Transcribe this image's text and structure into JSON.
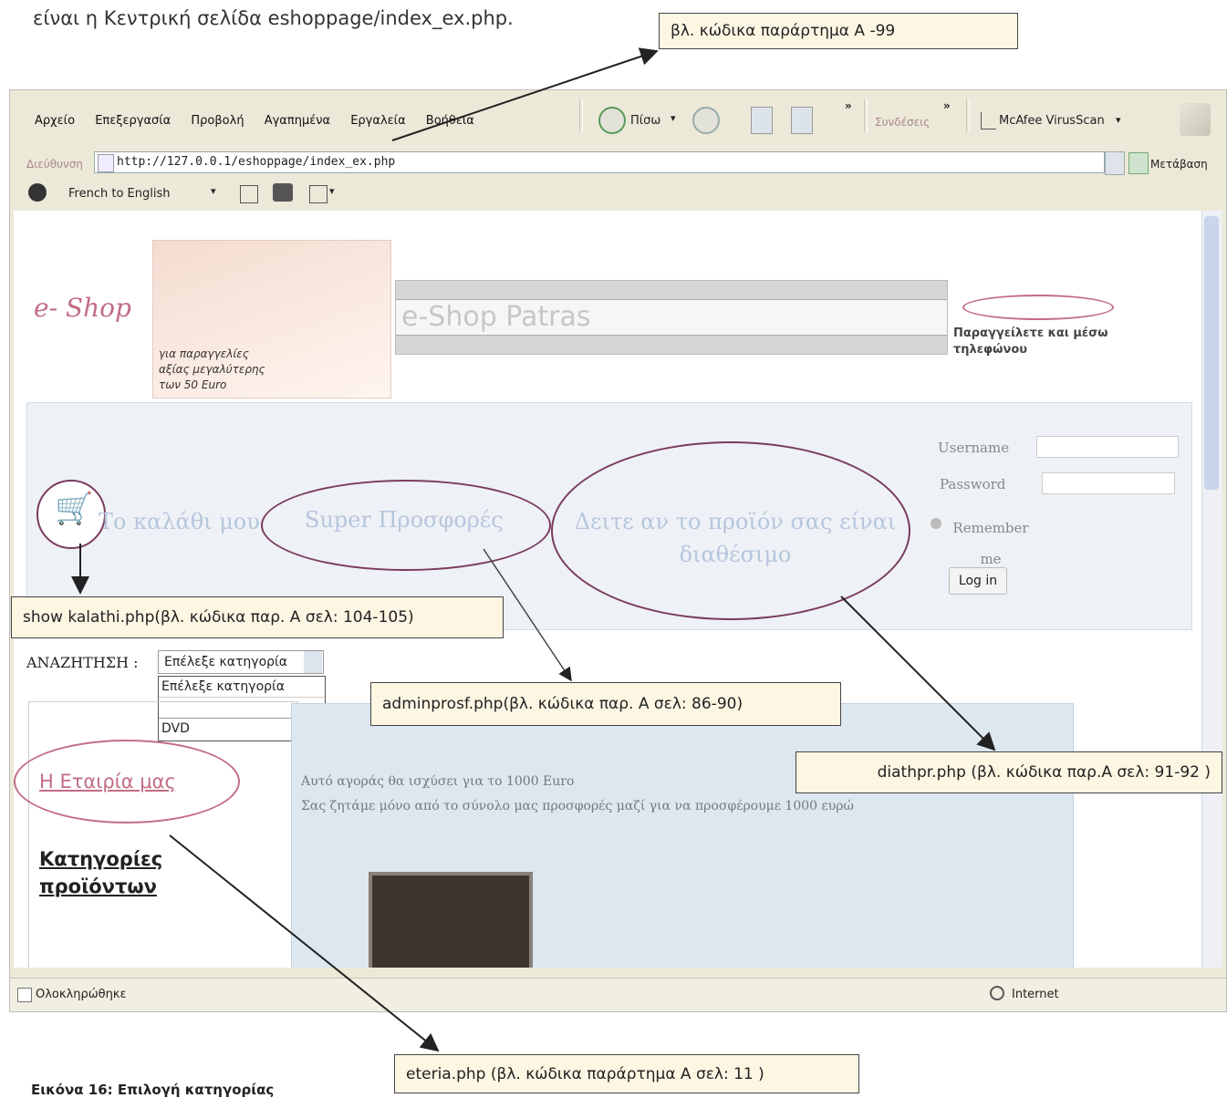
{
  "intro_text": "είναι η Κεντρική σελίδα eshoppage/index_ex.php.",
  "callouts": {
    "top": "βλ. κώδικα παράρτημα A -99",
    "kalathi": "show kalathi.php(βλ. κώδικα παρ. A σελ: 104-105)",
    "adminprosf": "adminprosf.php(βλ. κώδικα παρ. A σελ: 86-90)",
    "diathpr": "diathpr.php (βλ. κώδικα παρ.A σελ: 91-92 )",
    "eteria": "eteria.php (βλ. κώδικα παράρτημα A σελ: 11 )"
  },
  "browser": {
    "menu": [
      "Αρχείο",
      "Επεξεργασία",
      "Προβολή",
      "Αγαπημένα",
      "Εργαλεία",
      "Βοήθεια"
    ],
    "back_label": "Πίσω",
    "links_label": "Συνδέσεις",
    "mcafee_label": "McAfee VirusScan",
    "address_label": "Διεύθυνση",
    "url": "http://127.0.0.1/eshoppage/index_ex.php",
    "go_label": "Μετάβαση",
    "translate_label": "French to English",
    "status_done": "Ολοκληρώθηκε",
    "status_zone": "Internet"
  },
  "page": {
    "logo": "e- Shop",
    "banner_text": "για παραγγελίες αξίας μεγαλύτερης των 50 Euro",
    "banner_title": "e-Shop Patras",
    "phone_text": "Παραγγείλετε και μέσω τηλεφώνου",
    "cart_label": "Το καλάθι μου",
    "offers_label": "Super Προσφορές",
    "availability_label": "Δειτε αν το προϊόν σας είναι διαθέσιμο",
    "username_label": "Username",
    "password_label": "Password",
    "remember_label": "Remember me",
    "login_button": "Log in",
    "search_label": "ΑΝΑΖΗΤΗΣΗ :",
    "select_value": "Επέλεξε κατηγορία",
    "select_options": [
      "Επέλεξε κατηγορία",
      "",
      "DVD"
    ],
    "company_link": "Η Εταιρία μας",
    "categories_heading": "Κατηγορίες προϊόντων",
    "offer_text_1": "Αυτό αγοράς θα ισχύσει για το 1000 Euro",
    "offer_text_2": "Σας ζητάμε μόνο από το σύνολο μας προσφορές μαζί για να προσφέρουμε 1000 ευρώ"
  },
  "caption": "Εικόνα 16: Επιλογή κατηγορίας"
}
